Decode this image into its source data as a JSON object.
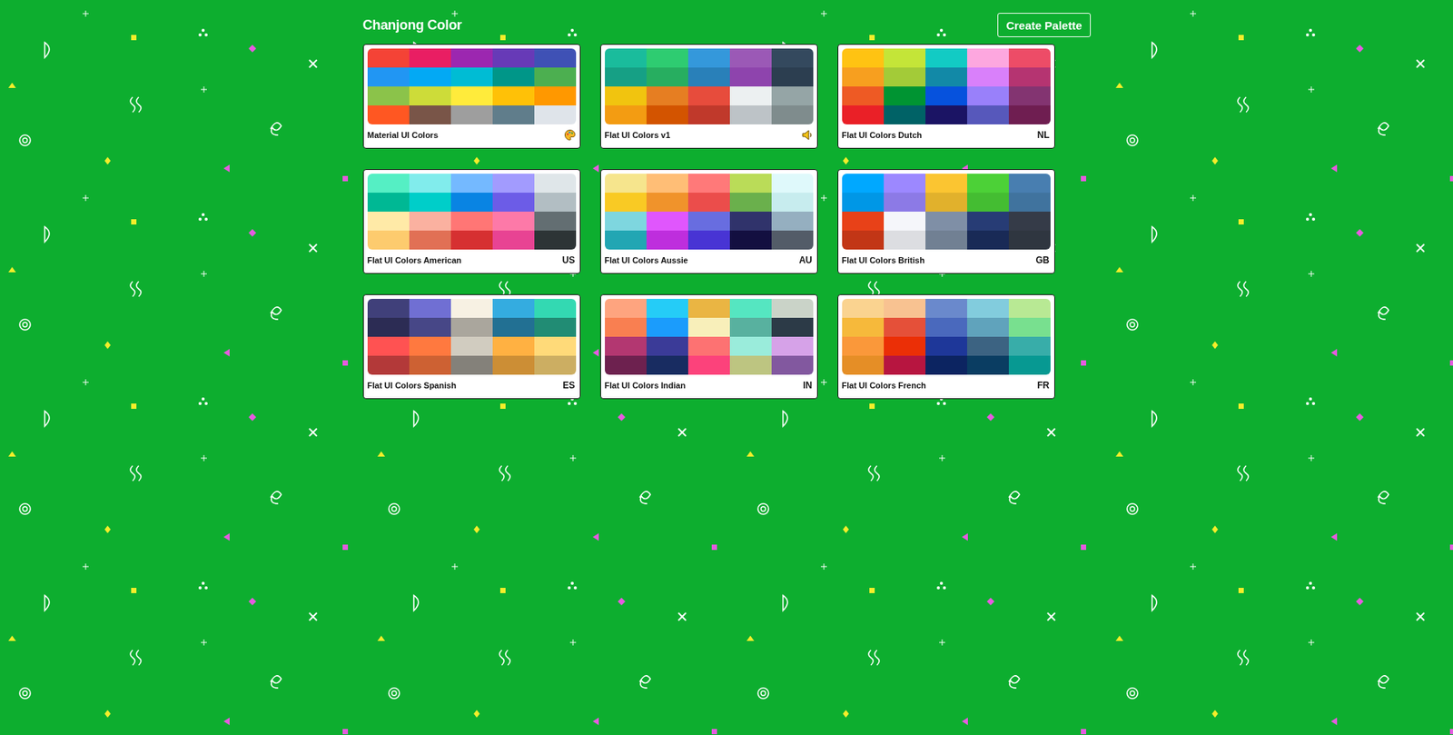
{
  "app": {
    "title": "Chanjong Color"
  },
  "header": {
    "button": "Create Palette"
  },
  "palettes": [
    {
      "name": "Material UI Colors",
      "badge": "",
      "icon": "palette",
      "swatches": [
        "#f44336",
        "#e91e63",
        "#9c27b0",
        "#673ab7",
        "#3f51b5",
        "#2196f3",
        "#03a9f4",
        "#00bcd4",
        "#009688",
        "#4caf50",
        "#8bc34a",
        "#cddc39",
        "#ffeb3b",
        "#ffc107",
        "#ff9800",
        "#ff5722",
        "#795548",
        "#9e9e9e",
        "#607d8b",
        "#dfe4ea"
      ]
    },
    {
      "name": "Flat UI Colors v1",
      "badge": "",
      "icon": "speaker",
      "swatches": [
        "#1abc9c",
        "#2ecc71",
        "#3498db",
        "#9b59b6",
        "#34495e",
        "#16a085",
        "#27ae60",
        "#2980b9",
        "#8e44ad",
        "#2c3e50",
        "#f1c40f",
        "#e67e22",
        "#e74c3c",
        "#ecf0f1",
        "#95a5a6",
        "#f39c12",
        "#d35400",
        "#c0392b",
        "#bdc3c7",
        "#7f8c8d"
      ]
    },
    {
      "name": "Flat UI Colors Dutch",
      "badge": "NL",
      "icon": "",
      "swatches": [
        "#ffc312",
        "#c4e538",
        "#12cbc4",
        "#fda7df",
        "#ed4c67",
        "#f79f1f",
        "#a3cb38",
        "#1289a7",
        "#d980fa",
        "#b53471",
        "#ee5a24",
        "#009432",
        "#0652dd",
        "#9980fa",
        "#833471",
        "#ea2027",
        "#006266",
        "#1b1464",
        "#5758bb",
        "#6f1e51"
      ]
    },
    {
      "name": "Flat UI Colors American",
      "badge": "US",
      "icon": "",
      "swatches": [
        "#55efc4",
        "#81ecec",
        "#74b9ff",
        "#a29bfe",
        "#dfe6e9",
        "#00b894",
        "#00cec9",
        "#0984e3",
        "#6c5ce7",
        "#b2bec3",
        "#ffeaa7",
        "#fab1a0",
        "#ff7675",
        "#fd79a8",
        "#636e72",
        "#fdcb6e",
        "#e17055",
        "#d63031",
        "#e84393",
        "#2d3436"
      ]
    },
    {
      "name": "Flat UI Colors Aussie",
      "badge": "AU",
      "icon": "",
      "swatches": [
        "#f6e58d",
        "#ffbe76",
        "#ff7979",
        "#badc58",
        "#dff9fb",
        "#f9ca24",
        "#f0932b",
        "#eb4d4b",
        "#6ab04c",
        "#c7ecee",
        "#7ed6df",
        "#e056fd",
        "#686de0",
        "#30336b",
        "#95afc0",
        "#22a6b3",
        "#be2edd",
        "#4834d4",
        "#130f40",
        "#535c68"
      ]
    },
    {
      "name": "Flat UI Colors British",
      "badge": "GB",
      "icon": "",
      "swatches": [
        "#00a8ff",
        "#9c88ff",
        "#fbc531",
        "#4cd137",
        "#487eb0",
        "#0097e6",
        "#8c7ae6",
        "#e1b12c",
        "#44bd32",
        "#40739e",
        "#e84118",
        "#f5f6fa",
        "#7f8fa6",
        "#273c75",
        "#353b48",
        "#c23616",
        "#dcdde1",
        "#718093",
        "#192a56",
        "#2f3640"
      ]
    },
    {
      "name": "Flat UI Colors Spanish",
      "badge": "ES",
      "icon": "",
      "swatches": [
        "#40407a",
        "#706fd3",
        "#f7f1e3",
        "#34ace0",
        "#33d9b2",
        "#2c2c54",
        "#474787",
        "#aaa69d",
        "#227093",
        "#218c74",
        "#ff5252",
        "#ff793f",
        "#d1ccc0",
        "#ffb142",
        "#ffda79",
        "#b33939",
        "#cd6133",
        "#84817a",
        "#cc8e35",
        "#ccae62"
      ]
    },
    {
      "name": "Flat UI Colors Indian",
      "badge": "IN",
      "icon": "",
      "swatches": [
        "#fea47f",
        "#25ccf7",
        "#eab543",
        "#55e6c1",
        "#cad3c8",
        "#f97f51",
        "#1b9cfc",
        "#f8efba",
        "#58b19f",
        "#2c3a47",
        "#b33771",
        "#3b3b98",
        "#fd7272",
        "#9aecdb",
        "#d6a2e8",
        "#6d214f",
        "#182c61",
        "#fc427b",
        "#bdc581",
        "#82589f"
      ]
    },
    {
      "name": "Flat UI Colors French",
      "badge": "FR",
      "icon": "",
      "swatches": [
        "#fad390",
        "#f8c291",
        "#6a89cc",
        "#82ccdd",
        "#b8e994",
        "#f6b93b",
        "#e55039",
        "#4a69bd",
        "#60a3bc",
        "#78e08f",
        "#fa983a",
        "#eb2f06",
        "#1e3799",
        "#3c6382",
        "#38ada9",
        "#e58e26",
        "#b71540",
        "#0c2461",
        "#0a3d62",
        "#079992"
      ]
    }
  ]
}
